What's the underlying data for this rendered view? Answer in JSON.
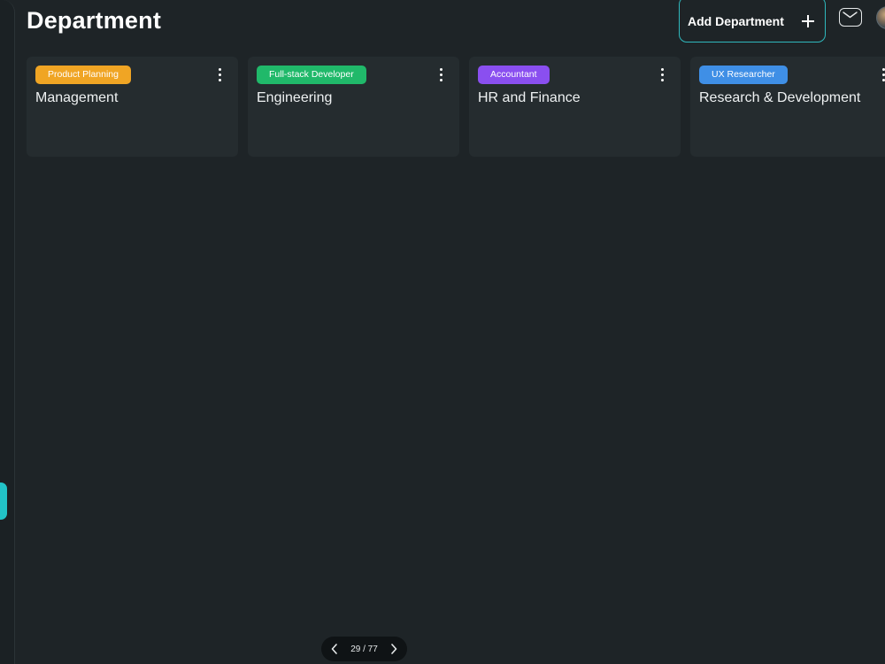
{
  "header": {
    "title": "Department",
    "add_button_label": "Add Department"
  },
  "icons": {
    "add": "plus-icon",
    "mail": "mail-icon",
    "avatar": "user-avatar",
    "more": "kebab-icon",
    "prev": "chevron-left-icon",
    "next": "chevron-right-icon"
  },
  "departments": [
    {
      "badge": "Product Planning",
      "badge_color": "#f0a524",
      "name": "Management"
    },
    {
      "badge": "Full-stack Developer",
      "badge_color": "#20b96a",
      "name": "Engineering"
    },
    {
      "badge": "Accountant",
      "badge_color": "#8a4ff0",
      "name": "HR and Finance"
    },
    {
      "badge": "UX Researcher",
      "badge_color": "#3f8fe6",
      "name": "Research & Development"
    }
  ],
  "pager": {
    "text": "29 / 77",
    "current": 29,
    "total": 77
  },
  "colors": {
    "background": "#1e2427",
    "card": "#252c2f",
    "accent": "#22c3c7"
  }
}
